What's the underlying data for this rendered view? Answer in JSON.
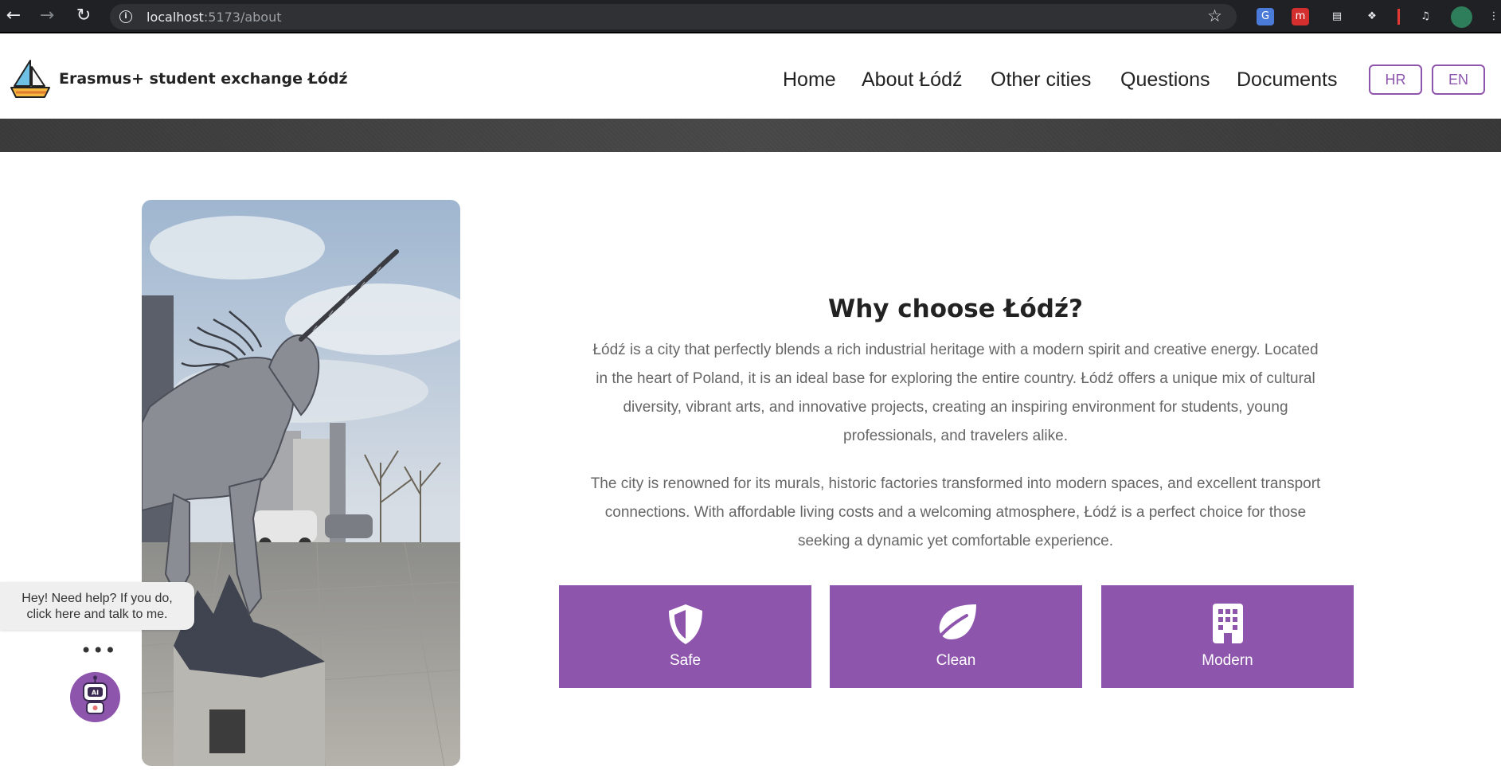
{
  "browser": {
    "url_host": "localhost",
    "url_path": ":5173/about",
    "back_icon": "arrow-left-icon",
    "forward_icon": "arrow-right-icon",
    "reload_icon": "reload-icon",
    "bookmark_icon": "star-icon"
  },
  "header": {
    "brand": "Erasmus+ student exchange Łódź",
    "nav": [
      "Home",
      "About Łódź",
      "Other cities",
      "Questions",
      "Documents"
    ],
    "languages": [
      "HR",
      "EN"
    ]
  },
  "main": {
    "heading": "Why choose Łódź?",
    "paragraph1_lines": [
      "Łódź is a city that perfectly blends a rich industrial heritage with a modern spirit and creative energy. Located",
      "in the heart of Poland, it is an ideal base for exploring the entire country. Łódź offers a unique mix of cultural",
      "diversity, vibrant arts, and innovative projects, creating an inspiring environment for students, young",
      "professionals, and travelers alike."
    ],
    "paragraph2_lines": [
      "The city is renowned for its murals, historic factories transformed into modern spaces, and excellent transport",
      "connections. With affordable living costs and a welcoming atmosphere, Łódź is a perfect choice for those",
      "seeking a dynamic yet comfortable experience."
    ],
    "features": [
      {
        "label": "Safe",
        "icon": "shield-icon"
      },
      {
        "label": "Clean",
        "icon": "leaf-icon"
      },
      {
        "label": "Modern",
        "icon": "building-icon"
      }
    ]
  },
  "chat": {
    "bubble_lines": [
      "Hey! Need help? If you do,",
      "click here and talk to me."
    ],
    "typing": "•••",
    "icon": "robot-icon"
  },
  "colors": {
    "accent": "#8e55ad",
    "browser_bg": "#202124"
  }
}
